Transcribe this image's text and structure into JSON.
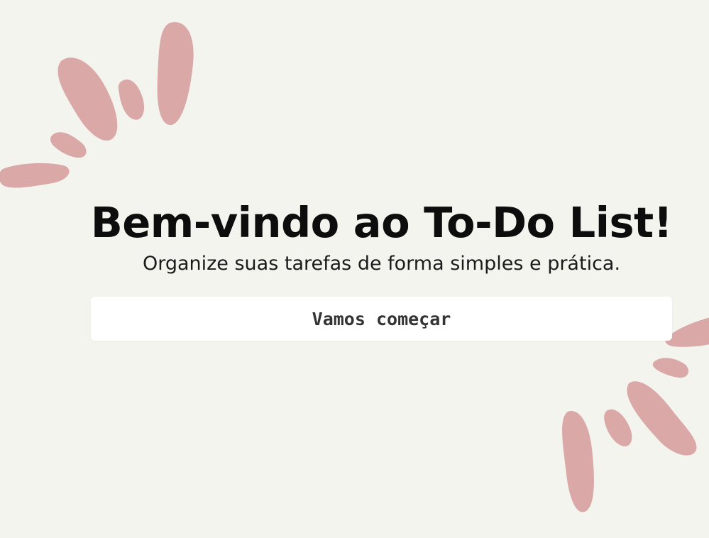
{
  "welcome": {
    "title": "Bem-vindo ao To-Do List!",
    "subtitle": "Organize suas tarefas de forma simples e prática.",
    "start_button_label": "Vamos começar"
  },
  "colors": {
    "background": "#f4f4ef",
    "accent_petals": "#dba8a8",
    "button_background": "#ffffff",
    "title_text": "#0d0d0d"
  },
  "icons": {
    "top_left_decoration": "petal-burst-icon",
    "bottom_right_decoration": "petal-burst-icon"
  }
}
